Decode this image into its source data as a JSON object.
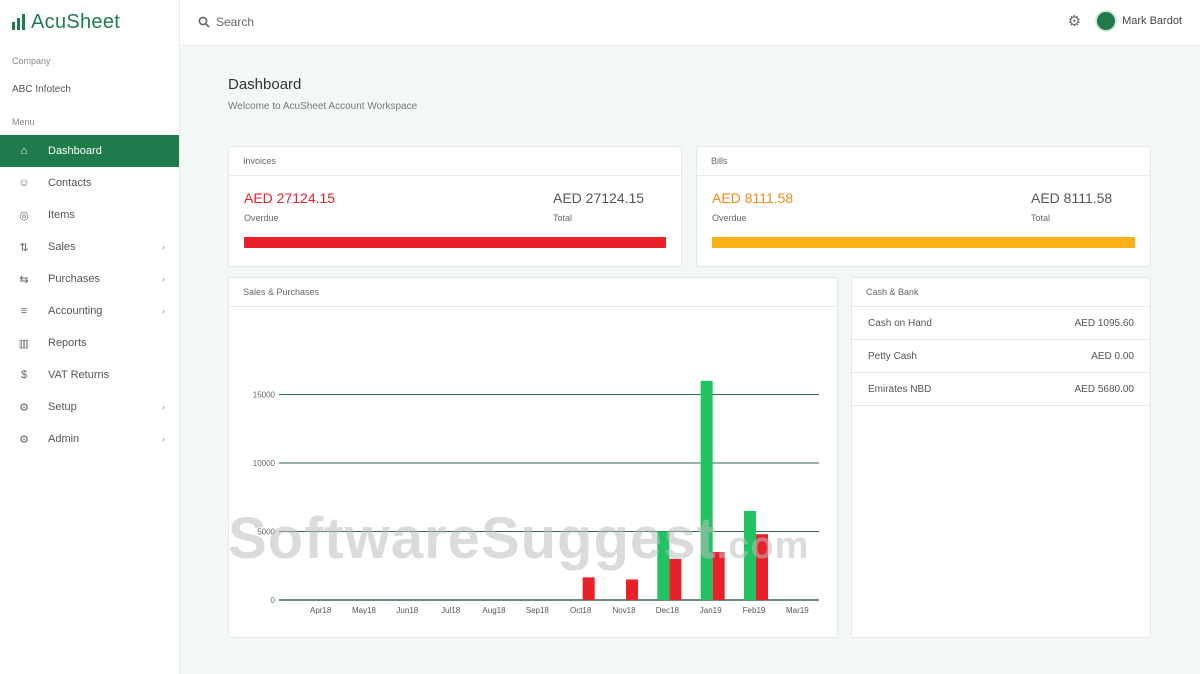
{
  "app": {
    "name": "AcuSheet"
  },
  "sidebar": {
    "company_label": "Company",
    "company_name": "ABC Infotech",
    "menu_label": "Menu",
    "items": [
      {
        "label": "Dashboard",
        "icon": "dashboard-icon",
        "glyph": "⌂",
        "active": true,
        "chevron": false
      },
      {
        "label": "Contacts",
        "icon": "contacts-icon",
        "glyph": "☺",
        "active": false,
        "chevron": false
      },
      {
        "label": "Items",
        "icon": "items-icon",
        "glyph": "◎",
        "active": false,
        "chevron": false
      },
      {
        "label": "Sales",
        "icon": "sales-icon",
        "glyph": "⇅",
        "active": false,
        "chevron": true
      },
      {
        "label": "Purchases",
        "icon": "purchases-icon",
        "glyph": "⇆",
        "active": false,
        "chevron": true
      },
      {
        "label": "Accounting",
        "icon": "accounting-icon",
        "glyph": "≡",
        "active": false,
        "chevron": true
      },
      {
        "label": "Reports",
        "icon": "reports-icon",
        "glyph": "▥",
        "active": false,
        "chevron": false
      },
      {
        "label": "VAT Returns",
        "icon": "vat-icon",
        "glyph": "$",
        "active": false,
        "chevron": false
      },
      {
        "label": "Setup",
        "icon": "setup-icon",
        "glyph": "⚙",
        "active": false,
        "chevron": true
      },
      {
        "label": "Admin",
        "icon": "admin-icon",
        "glyph": "⚙",
        "active": false,
        "chevron": true
      }
    ]
  },
  "topbar": {
    "search_label": "Search",
    "user_name": "Mark Bardot"
  },
  "page": {
    "title": "Dashboard",
    "subtitle": "Welcome to AcuSheet Account Workspace"
  },
  "invoices": {
    "header": "Invoices",
    "overdue_amount": "AED 27124.15",
    "overdue_label": "Overdue",
    "total_amount": "AED 27124.15",
    "total_label": "Total",
    "progress": 1.0,
    "color": "#e8202a"
  },
  "bills": {
    "header": "Bills",
    "overdue_amount": "AED 8111.58",
    "overdue_label": "Overdue",
    "total_amount": "AED 8111.58",
    "total_label": "Total",
    "progress": 1.0,
    "color": "#fbb018"
  },
  "sales_purchases": {
    "header": "Sales & Purchases"
  },
  "cash_bank": {
    "header": "Cash & Bank",
    "rows": [
      {
        "label": "Cash on Hand",
        "value": "AED 1095.60"
      },
      {
        "label": "Petty Cash",
        "value": "AED 0.00"
      },
      {
        "label": "Emirates NBD",
        "value": "AED 5680.00"
      }
    ]
  },
  "watermark": {
    "text": "SoftwareSuggest",
    "suffix": ".com"
  },
  "chart_data": {
    "type": "bar",
    "categories": [
      "Apr18",
      "May18",
      "Jun18",
      "Jul18",
      "Aug18",
      "Sep18",
      "Oct18",
      "Nov18",
      "Dec18",
      "Jan19",
      "Feb19",
      "Mar19"
    ],
    "y_tick_labels": [
      "15000",
      "10000",
      "5000",
      "0"
    ],
    "ylim": [
      0,
      20000
    ],
    "series": [
      {
        "values": [
          0,
          0,
          0,
          0,
          0,
          0,
          0,
          0,
          5000,
          16000,
          6500,
          0
        ],
        "color": "#21c262"
      },
      {
        "values": [
          0,
          0,
          0,
          0,
          0,
          0,
          1650,
          1500,
          3000,
          3500,
          4800,
          0
        ],
        "color": "#e8202a"
      }
    ]
  }
}
